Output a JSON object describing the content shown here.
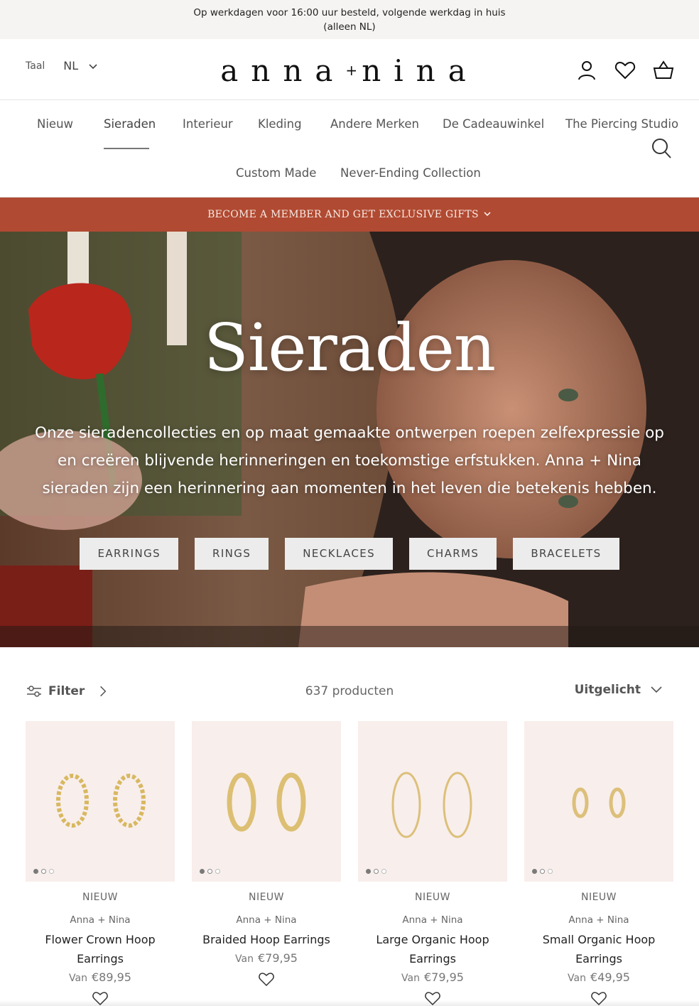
{
  "announcement": {
    "line1": "Op werkdagen voor 16:00 uur besteld, volgende werkdag in huis",
    "line2": "(alleen NL)"
  },
  "header": {
    "lang_label": "Taal",
    "lang_value": "NL",
    "logo_left": "anna",
    "logo_plus": "+",
    "logo_right": "nina",
    "icons": [
      "account-icon",
      "wishlist-heart-icon",
      "cart-basket-icon"
    ]
  },
  "nav": {
    "items": [
      "Nieuw",
      "Sieraden",
      "Interieur",
      "Kleding",
      "Andere Merken",
      "De Cadeauwinkel",
      "The Piercing Studio",
      "Custom Made",
      "Never-Ending Collection"
    ],
    "active": "Sieraden"
  },
  "promo": {
    "text": "BECOME A MEMBER AND GET EXCLUSIVE GIFTS"
  },
  "hero": {
    "title": "Sieraden",
    "description": "Onze sieradencollecties en op maat gemaakte ontwerpen roepen zelfexpressie op en creëren blijvende herinneringen en toekomstige erfstukken. Anna + Nina sieraden zijn een herinnering aan momenten in het leven die betekenis hebben.",
    "categories": [
      "EARRINGS",
      "RINGS",
      "NECKLACES",
      "CHARMS",
      "BRACELETS"
    ]
  },
  "toolbar": {
    "filter_label": "Filter",
    "count": "637 producten",
    "sort_label": "Uitgelicht"
  },
  "products": [
    {
      "badge": "NIEUW",
      "brand": "Anna + Nina",
      "name": "Flower Crown Hoop Earrings",
      "price_prefix": "Van",
      "price": "€89,95"
    },
    {
      "badge": "NIEUW",
      "brand": "Anna + Nina",
      "name": "Braided Hoop Earrings",
      "price_prefix": "Van",
      "price": "€79,95"
    },
    {
      "badge": "NIEUW",
      "brand": "Anna + Nina",
      "name": "Large Organic Hoop Earrings",
      "price_prefix": "Van",
      "price": "€79,95"
    },
    {
      "badge": "NIEUW",
      "brand": "Anna + Nina",
      "name": "Small Organic Hoop Earrings",
      "price_prefix": "Van",
      "price": "€49,95"
    }
  ],
  "colors": {
    "promo_bg": "#b14a32",
    "product_bg": "#f8eeec",
    "announce_bg": "#f6f4f2"
  }
}
